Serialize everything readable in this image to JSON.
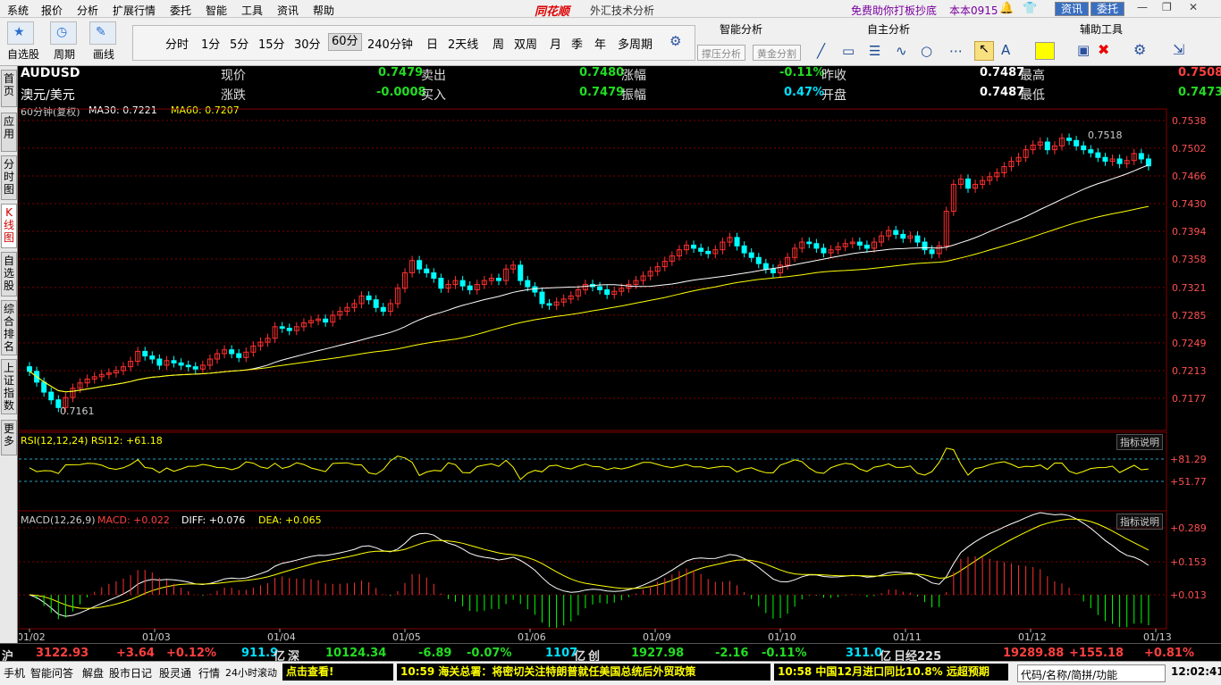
{
  "menu": [
    "系统",
    "报价",
    "分析",
    "扩展行情",
    "委托",
    "智能",
    "工具",
    "资讯",
    "帮助"
  ],
  "app": {
    "name": "同花顺",
    "title": "外汇技术分析",
    "promo": "免费助你打板抄底",
    "version": "本本0915",
    "btn_news": "资讯",
    "btn_trade": "委托"
  },
  "toolbar": {
    "labels": [
      "自选股",
      "周期",
      "画线"
    ],
    "periods": [
      "分时",
      "1分",
      "5分",
      "15分",
      "30分",
      "60分",
      "240分钟",
      "日",
      "2天线",
      "周",
      "双周",
      "月",
      "季",
      "年",
      "多周期"
    ],
    "active_period": "60分",
    "panels": [
      "智能分析",
      "自主分析",
      "辅助工具"
    ],
    "buttons": [
      "撑压分析",
      "黄金分割"
    ]
  },
  "sidetabs": [
    "首页",
    "应用",
    "分时图",
    "K线图",
    "自选股",
    "综合排名",
    "上证指数",
    "更多"
  ],
  "quote": {
    "code": "AUDUSD",
    "name": "澳元/美元",
    "labels": [
      "现价",
      "涨跌",
      "卖出",
      "买入",
      "涨幅",
      "振幅",
      "昨收",
      "开盘",
      "最高",
      "最低"
    ],
    "price": "0.7479",
    "change": "-0.0008",
    "ask": "0.7480",
    "bid": "0.7479",
    "pct": "-0.11%",
    "amp": "0.47%",
    "prev": "0.7487",
    "open": "0.7487",
    "high": "0.7508",
    "low": "0.7473"
  },
  "chart_head": {
    "period": "60分钟(复权)",
    "ma30": "MA30: 0.7221",
    "ma60": "MA60: 0.7207",
    "rsi": "RSI(12,12,24) RSI12: +61.18",
    "macd": "MACD(12,26,9)",
    "macd_val": "MACD: +0.022",
    "diff": "DIFF: +0.076",
    "dea": "DEA: +0.065",
    "explain": "指标说明"
  },
  "chart_data": {
    "type": "candlestick",
    "x_labels": [
      "01/02",
      "01/03",
      "01/04",
      "01/05",
      "01/06",
      "01/09",
      "01/10",
      "01/11",
      "01/12",
      "01/13"
    ],
    "y_ticks": [
      0.7538,
      0.7502,
      0.7466,
      0.743,
      0.7394,
      0.7358,
      0.7321,
      0.7285,
      0.7249,
      0.7213,
      0.7177
    ],
    "ylim": [
      0.7141,
      0.7546
    ],
    "annotations": {
      "high": "0.7518",
      "low": "0.7161"
    },
    "rsi_ticks": [
      "+81.29",
      "+51.77"
    ],
    "macd_ticks": [
      "+0.289",
      "+0.153",
      "+0.013"
    ],
    "close": [
      0.7212,
      0.7198,
      0.7185,
      0.7175,
      0.7165,
      0.7178,
      0.719,
      0.7197,
      0.7202,
      0.7205,
      0.7208,
      0.721,
      0.7213,
      0.7218,
      0.7225,
      0.7238,
      0.7232,
      0.7228,
      0.722,
      0.7226,
      0.7223,
      0.722,
      0.7218,
      0.7215,
      0.722,
      0.7228,
      0.7235,
      0.724,
      0.7235,
      0.723,
      0.7237,
      0.7245,
      0.725,
      0.7255,
      0.727,
      0.7268,
      0.7265,
      0.727,
      0.7275,
      0.7278,
      0.728,
      0.7276,
      0.7285,
      0.729,
      0.7295,
      0.73,
      0.731,
      0.7305,
      0.7295,
      0.729,
      0.73,
      0.732,
      0.734,
      0.7356,
      0.7345,
      0.734,
      0.7333,
      0.732,
      0.7325,
      0.733,
      0.7323,
      0.7318,
      0.7325,
      0.733,
      0.7333,
      0.733,
      0.7345,
      0.735,
      0.733,
      0.7322,
      0.7315,
      0.73,
      0.7298,
      0.7302,
      0.7306,
      0.731,
      0.7318,
      0.7325,
      0.7322,
      0.7318,
      0.7312,
      0.7316,
      0.732,
      0.7325,
      0.733,
      0.7336,
      0.7342,
      0.7348,
      0.7355,
      0.7362,
      0.737,
      0.7376,
      0.7372,
      0.7368,
      0.7365,
      0.737,
      0.738,
      0.7386,
      0.7375,
      0.7366,
      0.736,
      0.7352,
      0.7345,
      0.734,
      0.735,
      0.736,
      0.7372,
      0.738,
      0.7378,
      0.7372,
      0.7366,
      0.737,
      0.7374,
      0.7378,
      0.738,
      0.7376,
      0.7372,
      0.738,
      0.7388,
      0.7395,
      0.739,
      0.7385,
      0.7388,
      0.738,
      0.737,
      0.7365,
      0.7375,
      0.742,
      0.7455,
      0.7462,
      0.745,
      0.7455,
      0.746,
      0.7465,
      0.747,
      0.7478,
      0.7485,
      0.749,
      0.75,
      0.7506,
      0.751,
      0.75,
      0.7505,
      0.7515,
      0.7512,
      0.7505,
      0.75,
      0.7496,
      0.749,
      0.7485,
      0.7488,
      0.7482,
      0.7486,
      0.7495,
      0.7488,
      0.7479
    ]
  },
  "bottom": {
    "sh_label": "沪",
    "sh": "3122.93",
    "sh_chg": "+3.64",
    "sh_pct": "+0.12%",
    "sh_vol": "911.9",
    "sz_label": "深",
    "sz": "10124.34",
    "sz_chg": "-6.89",
    "sz_pct": "-0.07%",
    "sz_vol": "1107",
    "cy_label": "创",
    "cy": "1927.98",
    "cy_chg": "-2.16",
    "cy_pct": "-0.11%",
    "cy_vol": "311.0",
    "unit": "亿",
    "nk_label": "日经225",
    "nk": "19289.88",
    "nk_chg": "+155.18",
    "nk_pct": "+0.81%"
  },
  "status": {
    "items": [
      "手机",
      "智能问答",
      "解盘",
      "股市日记",
      "股灵通",
      "行情",
      "24小时滚动"
    ],
    "ticker1": "点击查看!",
    "ticker2": "10:59 海关总署：将密切关注特朗普就任美国总统后外贸政策",
    "ticker3": "10:58 中国12月进口同比10.8% 远超预期",
    "search": "代码/名称/简拼/功能",
    "time": "12:02:41"
  },
  "colors": {
    "up": "#ff3030",
    "down": "#00ffff",
    "ma30": "#ffffff",
    "ma60": "#ffff00",
    "grid": "#800000"
  }
}
